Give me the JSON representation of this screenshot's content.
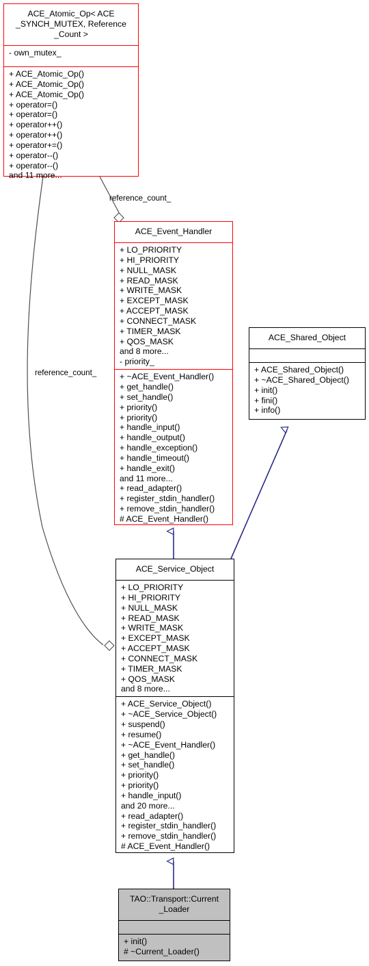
{
  "diagram": {
    "kind": "uml-class-diagram",
    "colors": {
      "template_class_border": "#ff0000",
      "class_border": "#000000",
      "highlight_fill": "#c0c0c0",
      "inheritance_edge": "#292986",
      "association_edge": "#4d4d4d",
      "background": "#ffffff"
    }
  },
  "classes": {
    "atomic_op": {
      "name": "ACE_Atomic_Op< ACE\n_SYNCH_MUTEX, Reference\n_Count >",
      "title_lines": [
        "ACE_Atomic_Op< ACE",
        "_SYNCH_MUTEX, Reference",
        "_Count >"
      ],
      "attributes": [
        "- own_mutex_"
      ],
      "operations": [
        "+ ACE_Atomic_Op()",
        "+ ACE_Atomic_Op()",
        "+ ACE_Atomic_Op()",
        "+ operator=()",
        "+ operator=()",
        "+ operator++()",
        "+ operator++()",
        "+ operator+=()",
        "+ operator--()",
        "+ operator--()",
        "and 11 more..."
      ]
    },
    "event_handler": {
      "name": "ACE_Event_Handler",
      "title_lines": [
        "ACE_Event_Handler"
      ],
      "attributes": [
        "+ LO_PRIORITY",
        "+ HI_PRIORITY",
        "+ NULL_MASK",
        "+ READ_MASK",
        "+ WRITE_MASK",
        "+ EXCEPT_MASK",
        "+ ACCEPT_MASK",
        "+ CONNECT_MASK",
        "+ TIMER_MASK",
        "+ QOS_MASK",
        "and 8 more...",
        "- priority_"
      ],
      "operations": [
        "+ ~ACE_Event_Handler()",
        "+ get_handle()",
        "+ set_handle()",
        "+ priority()",
        "+ priority()",
        "+ handle_input()",
        "+ handle_output()",
        "+ handle_exception()",
        "+ handle_timeout()",
        "+ handle_exit()",
        "and 11 more...",
        "+ read_adapter()",
        "+ register_stdin_handler()",
        "+ remove_stdin_handler()",
        "# ACE_Event_Handler()"
      ]
    },
    "shared_object": {
      "name": "ACE_Shared_Object",
      "title_lines": [
        "ACE_Shared_Object"
      ],
      "attributes": [],
      "operations": [
        "+ ACE_Shared_Object()",
        "+ ~ACE_Shared_Object()",
        "+ init()",
        "+ fini()",
        "+ info()"
      ]
    },
    "service_object": {
      "name": "ACE_Service_Object",
      "title_lines": [
        "ACE_Service_Object"
      ],
      "attributes": [
        "+ LO_PRIORITY",
        "+ HI_PRIORITY",
        "+ NULL_MASK",
        "+ READ_MASK",
        "+ WRITE_MASK",
        "+ EXCEPT_MASK",
        "+ ACCEPT_MASK",
        "+ CONNECT_MASK",
        "+ TIMER_MASK",
        "+ QOS_MASK",
        "and 8 more..."
      ],
      "operations": [
        "+ ACE_Service_Object()",
        "+ ~ACE_Service_Object()",
        "+ suspend()",
        "+ resume()",
        "+ ~ACE_Event_Handler()",
        "+ get_handle()",
        "+ set_handle()",
        "+ priority()",
        "+ priority()",
        "+ handle_input()",
        "and 20 more...",
        "+ read_adapter()",
        "+ register_stdin_handler()",
        "+ remove_stdin_handler()",
        "# ACE_Event_Handler()"
      ]
    },
    "current_loader": {
      "name": "TAO::Transport::Current_Loader",
      "title_lines": [
        "TAO::Transport::Current",
        "_Loader"
      ],
      "attributes": [],
      "operations": [
        "+ init()",
        "# ~Current_Loader()"
      ]
    }
  },
  "edges": {
    "atomic_to_event_handler": {
      "label": "reference_count_",
      "type": "aggregation",
      "from": "atomic_op",
      "to": "event_handler"
    },
    "atomic_to_service_object": {
      "label": "reference_count_",
      "type": "aggregation",
      "from": "atomic_op",
      "to": "service_object"
    },
    "event_handler_to_service_object": {
      "label": "",
      "type": "inheritance",
      "from": "service_object",
      "to": "event_handler"
    },
    "shared_object_to_service_object": {
      "label": "",
      "type": "inheritance",
      "from": "service_object",
      "to": "shared_object"
    },
    "service_object_to_current_loader": {
      "label": "",
      "type": "inheritance",
      "from": "current_loader",
      "to": "service_object"
    }
  }
}
